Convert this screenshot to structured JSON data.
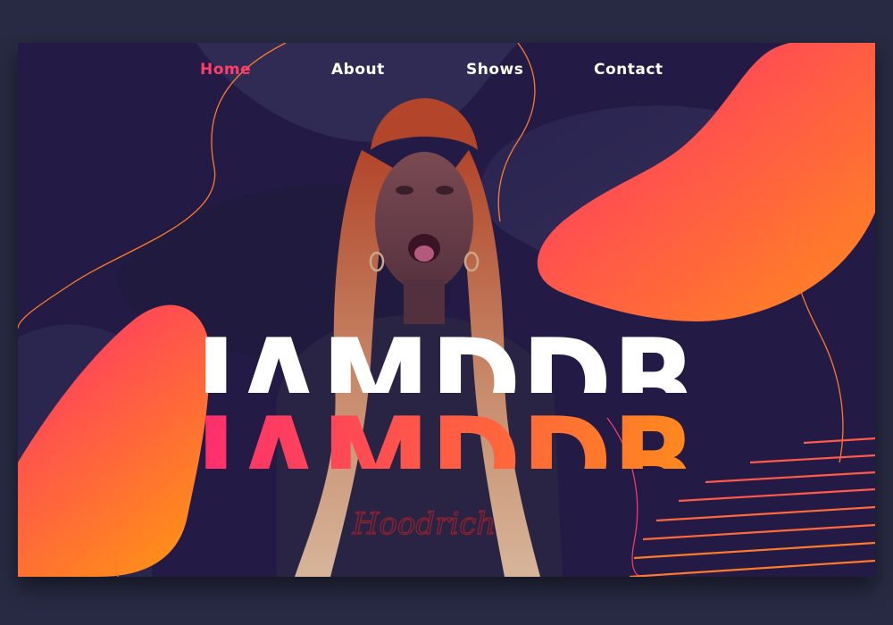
{
  "nav": {
    "items": [
      {
        "label": "Home",
        "active": true
      },
      {
        "label": "About",
        "active": false
      },
      {
        "label": "Shows",
        "active": false
      },
      {
        "label": "Contact",
        "active": false
      }
    ]
  },
  "hero": {
    "title": "IAMDDB",
    "shirt_text": "Hoodrich"
  },
  "colors": {
    "background": "#272a42",
    "card": "#231b45",
    "accent_pink": "#ff2d6e",
    "accent_orange": "#ff8a1c",
    "text": "#ffffff"
  }
}
